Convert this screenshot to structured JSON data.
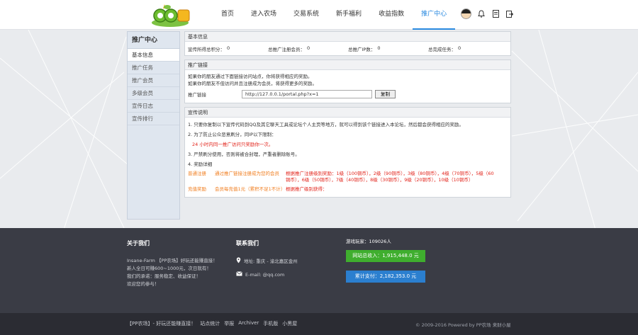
{
  "header": {
    "logo_alt": "QQ农场",
    "nav": [
      "首页",
      "进入农场",
      "交易系统",
      "新手福利",
      "收益指数",
      "推广中心"
    ],
    "active_nav": 5,
    "icons": [
      "avatar",
      "bell-icon",
      "document-icon",
      "logout-icon"
    ]
  },
  "sidebar": {
    "title": "推广中心",
    "items": [
      "基本信息",
      "推广任务",
      "推广会员",
      "多级会员",
      "宣传日志",
      "宣传排行"
    ],
    "active": 0
  },
  "basic_info": {
    "title": "基本信息",
    "stats": [
      {
        "label": "宣传所得总积分：",
        "value": "0"
      },
      {
        "label": "总推广注册会员：",
        "value": "0"
      },
      {
        "label": "总推广IP数：",
        "value": "0"
      },
      {
        "label": "总完成任务：",
        "value": "0"
      }
    ]
  },
  "promo_link": {
    "title": "推广链接",
    "desc1": "如果你的朋友通过下面链接访问站点，你将获得相应的奖励。",
    "desc2": "如果你的朋友不但访问并且注册成为会员，将获得更多的奖励。",
    "label": "推广链接",
    "url": "http://127.0.0.1/portal.php?x=1",
    "copy_label": "复制"
  },
  "notes": {
    "title": "宣传说明",
    "line1": "1. 只要你复制以下宣传代码到QQ及其它聊天工具或论坛个人主页等地方，就可以得到该个链接进入本论坛，然后都会获得相应的奖励。",
    "line2": "2. 为了防止公众恶意刷分，同IP以下限制：",
    "line2_red": "24 小时内同一推广访问只奖励你一次。",
    "line3": "3. 严禁刷分使用，否则将被合封理，严重者删除账号。",
    "line4": "4. 奖励详细",
    "rows": [
      {
        "col1": "普通注册",
        "col2": "通过推广链接注册成为您的会员",
        "col3": "根据推广注册级别奖励：1级（100铜币），2级（90铜币），3级（80铜币），4级（70铜币），5级（60铜币），6级（50铜币），7级（40铜币），8级（30铜币），9级（20铜币），10级（10铜币）"
      },
      {
        "col1": "充值奖励",
        "col2": "会员每充值1元（累积不足1不计）",
        "col3": "根据推广级别获得："
      }
    ]
  },
  "footer": {
    "about_title": "关于我们",
    "about_lines": [
      "Insane-Farm 【PP农场】好玩还能赚直接！",
      "新人全日可赚600~1000元，次日就有！",
      "我们的承诺：服务稳定、收益保证！",
      "欢迎您的参与！"
    ],
    "contact_title": "联系我们",
    "address": "地址: 重庆 - 渝北嘉区金州",
    "email": "E-mail: @qq.com",
    "stats_label": "游戏玩家：",
    "stats_value": "109026人",
    "recharge": "网站总收入：1,915,448.0 元",
    "withdraw": "累计支付：2,182,353.0 元"
  },
  "bottom": {
    "links": [
      "【PP农场】- 好玩还能赚直接！",
      "站点统计",
      "举报",
      "Archiver",
      "手机版",
      "小黑屋"
    ],
    "copyright": "© 2009-2016 Powered by PP农场 来财小屋"
  }
}
